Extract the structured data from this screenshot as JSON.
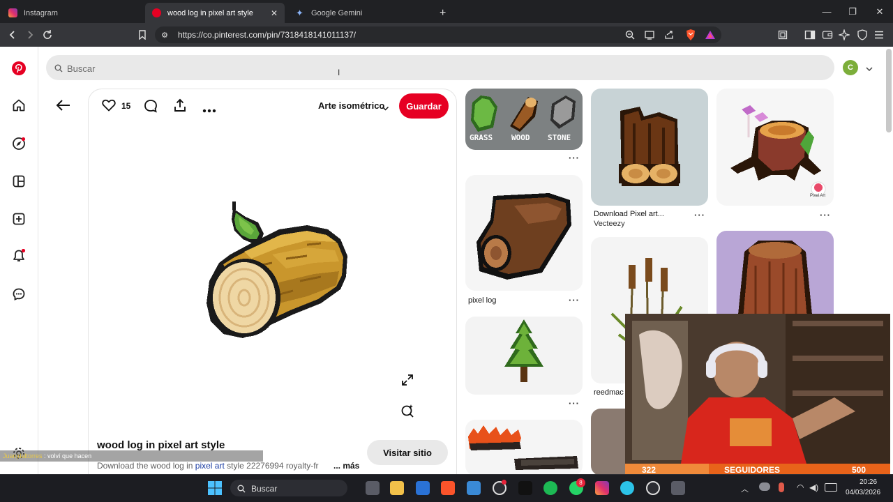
{
  "browser": {
    "tabs": [
      {
        "label": "Instagram",
        "active": false
      },
      {
        "label": "wood log in pixel art style",
        "active": true
      },
      {
        "label": "Google Gemini",
        "active": false
      }
    ],
    "new_tab": "+",
    "url": "https://co.pinterest.com/pin/7318418141011137/"
  },
  "pinterest": {
    "search_placeholder": "Buscar",
    "avatar_letter": "C",
    "likes": "15",
    "board": "Arte isométrico",
    "save_label": "Guardar",
    "title": "wood log in pixel art style",
    "description_prefix": "Download the wood log in ",
    "description_link": "pixel art",
    "description_suffix": " style 22276994 royalty-fr",
    "more_label": "... más",
    "visit_label": "Visitar sitio",
    "related": {
      "grass_label": "GRASS",
      "wood_label": "WOOD",
      "stone_label": "STONE",
      "pixel_log": "pixel log",
      "download_title": "Download Pixel art...",
      "download_author": "Vecteezy",
      "reedmac": "reedmac",
      "badge": "Pixel Art"
    }
  },
  "overlay": {
    "chat_user": "Juanjdaltorres",
    "chat_message": "volví que hacen",
    "followers_current": "322",
    "followers_label": "SEGUIDORES",
    "followers_goal": "500"
  },
  "taskbar": {
    "search_placeholder": "Buscar",
    "time": "20:26",
    "date": "04/03/2026",
    "whatsapp_badge": "8"
  },
  "colors": {
    "pinterest_red": "#e60023",
    "chrome_dark": "#202124",
    "toolbar": "#35363a",
    "overlay_orange": "#e8631a"
  }
}
